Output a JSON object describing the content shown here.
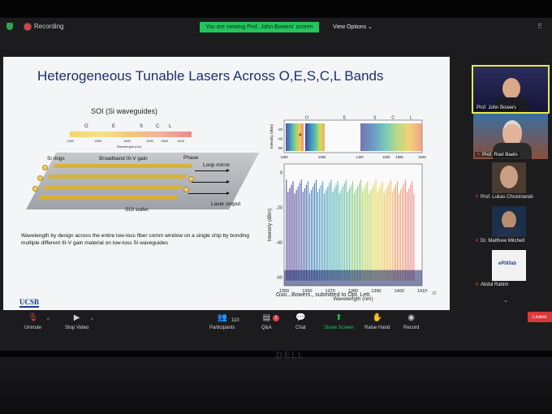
{
  "topbar": {
    "recording_label": "Recording",
    "viewing_banner": "You are viewing Prof. John Bowers' screen",
    "view_options_label": "View Options ⌄"
  },
  "slide": {
    "title": "Heterogeneous Tunable Lasers Across O,E,S,C,L Bands",
    "subtitle": "SOI (Si waveguides)",
    "band_labels": [
      "O",
      "E",
      "S",
      "C",
      "L"
    ],
    "band_ticks": [
      "1260",
      "1360",
      "1460",
      "1530",
      "1565",
      "1625"
    ],
    "wavelength_axis": "Wavelength (nm)",
    "chip_labels": {
      "si_rings": "Si rings",
      "gain": "Broadband III-V gain",
      "phase": "Phase",
      "loop_mirror": "Loop mirror",
      "soi_wafer": "SOI wafer",
      "laser_output": "Laser output"
    },
    "description": "Wavelength by design across the entire low-loss fiber comm window on a single chip by bonding multiple different III-V gain material on low-loss Si waveguides",
    "logo": "UCSB",
    "reference": "Guo...Bowers., submitted to Opt. Lett.",
    "page_number": "25"
  },
  "chart_data": [
    {
      "type": "line",
      "title": "",
      "band_labels": [
        "O",
        "E",
        "S",
        "C",
        "L"
      ],
      "xlabel": "",
      "ylabel": "Intensity (dBm)",
      "x_ticks": [
        1260,
        1360,
        1460,
        1530,
        1565,
        1625
      ],
      "y_ticks": [
        -20,
        -40,
        -60
      ],
      "ylim": [
        -70,
        0
      ]
    },
    {
      "type": "line",
      "title": "",
      "xlabel": "Wavelength (nm)",
      "ylabel": "Intensity (dBm)",
      "x_ticks": [
        1350,
        1360,
        1370,
        1380,
        1390,
        1400,
        1410
      ],
      "y_ticks": [
        0,
        -20,
        -40,
        -60
      ],
      "xlim": [
        1350,
        1410
      ],
      "ylim": [
        -65,
        5
      ]
    }
  ],
  "participants": [
    {
      "name": "Prof. John Bowers"
    },
    {
      "name": "Prof. Roel Baets"
    },
    {
      "name": "Prof. Lukas Chrostowski"
    },
    {
      "name": "Dr. Matthew Mitchell"
    },
    {
      "name": "Abdul Rahim"
    }
  ],
  "epixfab_logo": "ePIXfab",
  "toolbar": {
    "unmute": "Unmute",
    "stop_video": "Stop Video",
    "participants": "Participants",
    "participant_count": "110",
    "qa": "Q&A",
    "qa_badge": "2",
    "chat": "Chat",
    "share_screen": "Share Screen",
    "raise_hand": "Raise Hand",
    "record": "Record",
    "leave": "Leave"
  },
  "device": {
    "brand": "DELL"
  },
  "colors": {
    "banner_green": "#22c55e",
    "leave_red": "#d9383a",
    "slide_title_blue": "#1c2f6e",
    "active_speaker_outline": "#e8e84a"
  }
}
